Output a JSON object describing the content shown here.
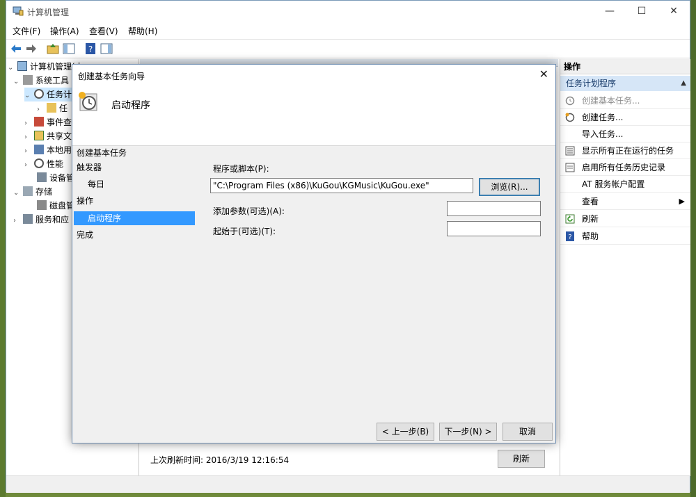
{
  "window": {
    "title": "计算机管理",
    "min": "—",
    "max": "☐",
    "close": "✕"
  },
  "menu": [
    "文件(F)",
    "操作(A)",
    "查看(V)",
    "帮助(H)"
  ],
  "tree": {
    "root": "计算机管理(本",
    "system_tools": "系统工具",
    "task_scheduler": "任务计",
    "task_lib": "任",
    "event_viewer": "事件查",
    "shared_folders": "共享文",
    "local_users": "本地用",
    "performance": "性能",
    "device_manager": "设备管",
    "storage": "存储",
    "disk_mgmt": "磁盘管",
    "services": "服务和应"
  },
  "center": {
    "last_refresh": "上次刷新时间: 2016/3/19 12:16:54",
    "refresh_button": "刷新"
  },
  "actions": {
    "header": "操作",
    "group": "任务计划程序",
    "items": [
      {
        "label": "创建基本任务...",
        "icon": "wizard-icon",
        "disabled": true
      },
      {
        "label": "创建任务...",
        "icon": "task-icon"
      },
      {
        "label": "导入任务...",
        "icon": ""
      },
      {
        "label": "显示所有正在运行的任务",
        "icon": "list-icon"
      },
      {
        "label": "启用所有任务历史记录",
        "icon": "history-icon"
      },
      {
        "label": "AT 服务帐户配置",
        "icon": ""
      },
      {
        "label": "查看",
        "icon": "",
        "submenu": "▶"
      },
      {
        "label": "刷新",
        "icon": "refresh-icon"
      },
      {
        "label": "帮助",
        "icon": "help-icon"
      }
    ]
  },
  "dialog": {
    "title": "创建基本任务向导",
    "heading": "启动程序",
    "close": "✕",
    "steps_title": "创建基本任务",
    "steps": [
      "触发器",
      "每日",
      "操作",
      "启动程序",
      "完成"
    ],
    "program_label": "程序或脚本(P):",
    "program_value": "\"C:\\Program Files (x86)\\KuGou\\KGMusic\\KuGou.exe\"",
    "browse": "浏览(R)...",
    "args_label": "添加参数(可选)(A):",
    "args_value": "",
    "start_label": "起始于(可选)(T):",
    "start_value": "",
    "back": "< 上一步(B)",
    "next": "下一步(N) >",
    "cancel": "取消"
  },
  "colors": {
    "selection": "#3399ff",
    "accent": "#1a3d6b"
  }
}
